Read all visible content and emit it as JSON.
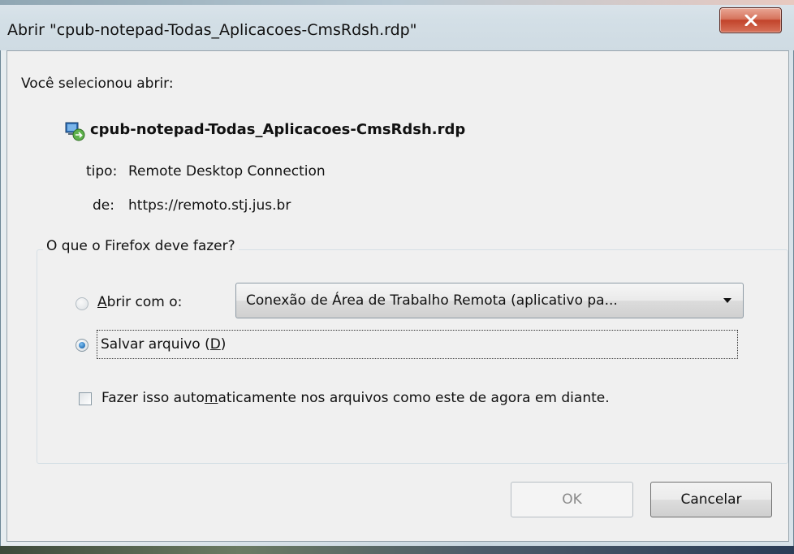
{
  "window": {
    "title": "Abrir \"cpub-notepad-Todas_Aplicacoes-CmsRdsh.rdp\"",
    "close_icon": "close-icon"
  },
  "intro": "Você selecionou abrir:",
  "file": {
    "icon": "rdp-file-icon",
    "name": "cpub-notepad-Todas_Aplicacoes-CmsRdsh.rdp",
    "type_label": "tipo:",
    "type_value": "Remote Desktop Connection",
    "from_label": "de:",
    "from_value": "https://remoto.stj.jus.br"
  },
  "action_group": {
    "legend": "O que o Firefox deve fazer?",
    "open_with": {
      "accesskey": "A",
      "label_rest": "brir com o:",
      "selected": false,
      "app_selected": "Conexão de Área de Trabalho Remota (aplicativo pa..."
    },
    "save_file": {
      "label_prefix": "Salvar arquivo (",
      "accesskey": "D",
      "label_suffix": ")",
      "selected": true
    },
    "auto": {
      "label_prefix": "Fazer isso auto",
      "accesskey": "m",
      "label_suffix": "aticamente nos arquivos como este de agora em diante.",
      "checked": false
    }
  },
  "buttons": {
    "ok": "OK",
    "cancel": "Cancelar"
  },
  "colors": {
    "close_button": "#c2432a",
    "radio_dot": "#1c68b0"
  }
}
